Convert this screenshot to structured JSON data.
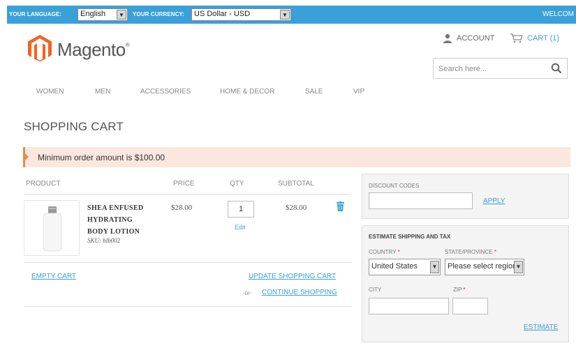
{
  "topbar": {
    "language_label": "YOUR LANGUAGE:",
    "language_value": "English",
    "currency_label": "YOUR CURRENCY:",
    "currency_value": "US Dollar - USD",
    "welcome": "WELCOM"
  },
  "header": {
    "logo_text": "Magento",
    "logo_mark": "®",
    "account_label": "ACCOUNT",
    "cart_label": "CART (1)",
    "search_placeholder": "Search here..."
  },
  "nav": {
    "items": [
      "WOMEN",
      "MEN",
      "ACCESSORIES",
      "HOME & DECOR",
      "SALE",
      "VIP"
    ]
  },
  "page_title": "SHOPPING CART",
  "alert": "Minimum order amount is $100.00",
  "cart_table": {
    "columns": [
      "PRODUCT",
      "PRICE",
      "QTY",
      "SUBTOTAL"
    ],
    "rows": [
      {
        "name_lines": [
          "SHEA ENFUSED",
          "HYDRATING",
          "BODY LOTION"
        ],
        "sku": "SKU: hlb002",
        "price": "$28.00",
        "qty": "1",
        "edit_label": "Edit",
        "subtotal": "$28.00"
      }
    ]
  },
  "actions": {
    "empty_cart": "EMPTY CART",
    "update_cart": "UPDATE SHOPPING CART",
    "or": "-or-",
    "continue_shopping": "CONTINUE SHOPPING"
  },
  "discount": {
    "heading": "DISCOUNT CODES",
    "apply": "APPLY"
  },
  "shipping": {
    "heading": "ESTIMATE SHIPPING AND TAX",
    "country_label": "COUNTRY",
    "country_value": "United States",
    "state_label": "STATE/PROVINCE",
    "state_value": "Please select region",
    "city_label": "CITY",
    "zip_label": "ZIP",
    "required_mark": "*",
    "estimate": "ESTIMATE"
  },
  "colors": {
    "accent": "#3aa0d8",
    "alert_bg": "#fbe7de",
    "alert_border": "#e58c4a",
    "logo_orange": "#f26322"
  },
  "icons": [
    "dropdown-arrow-icon",
    "magento-logo-icon",
    "user-icon",
    "cart-icon",
    "search-icon",
    "trash-icon",
    "alert-arrow-icon"
  ]
}
